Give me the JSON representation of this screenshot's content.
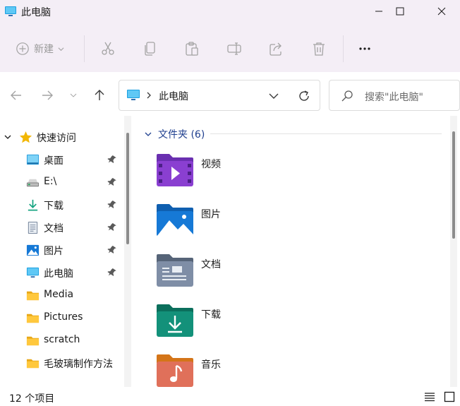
{
  "window": {
    "title": "此电脑",
    "icon": "this-pc-icon"
  },
  "toolbar": {
    "new_label": "新建",
    "buttons": [
      "cut-icon",
      "copy-icon",
      "paste-icon",
      "rename-icon",
      "share-icon",
      "delete-icon",
      "more-icon"
    ],
    "more_label": "···"
  },
  "address": {
    "path": "此电脑",
    "icon": "this-pc-icon"
  },
  "search": {
    "placeholder": "搜索\"此电脑\""
  },
  "sidebar": {
    "quick_access": "快速访问",
    "items": [
      {
        "label": "桌面",
        "icon": "desktop-icon",
        "pinned": true
      },
      {
        "label": "E:\\",
        "icon": "drive-icon",
        "pinned": true
      },
      {
        "label": "下载",
        "icon": "download-icon",
        "pinned": true
      },
      {
        "label": "文档",
        "icon": "document-icon",
        "pinned": true
      },
      {
        "label": "图片",
        "icon": "picture-icon",
        "pinned": true
      },
      {
        "label": "此电脑",
        "icon": "this-pc-icon",
        "pinned": true
      },
      {
        "label": "Media",
        "icon": "folder-icon",
        "pinned": false
      },
      {
        "label": "Pictures",
        "icon": "folder-icon",
        "pinned": false
      },
      {
        "label": "scratch",
        "icon": "folder-icon",
        "pinned": false
      },
      {
        "label": "毛玻璃制作方法",
        "icon": "folder-icon",
        "pinned": false
      }
    ]
  },
  "main": {
    "group_label": "文件夹 (6)",
    "folders": [
      {
        "label": "视频",
        "icon": "videos-folder-icon"
      },
      {
        "label": "图片",
        "icon": "pictures-folder-icon"
      },
      {
        "label": "文档",
        "icon": "documents-folder-icon"
      },
      {
        "label": "下载",
        "icon": "downloads-folder-icon"
      },
      {
        "label": "音乐",
        "icon": "music-folder-icon"
      }
    ]
  },
  "status": {
    "item_count": "12 个项目"
  },
  "colors": {
    "chrome_bg": "#f4eef6",
    "group_text": "#1f3f8f",
    "video_folder": "#8a3fd1",
    "pictures_folder": "#1679d6",
    "documents_folder": "#6f7f96",
    "downloads_folder": "#13917a",
    "music_folder": "#e0705a",
    "star": "#f2b705"
  }
}
